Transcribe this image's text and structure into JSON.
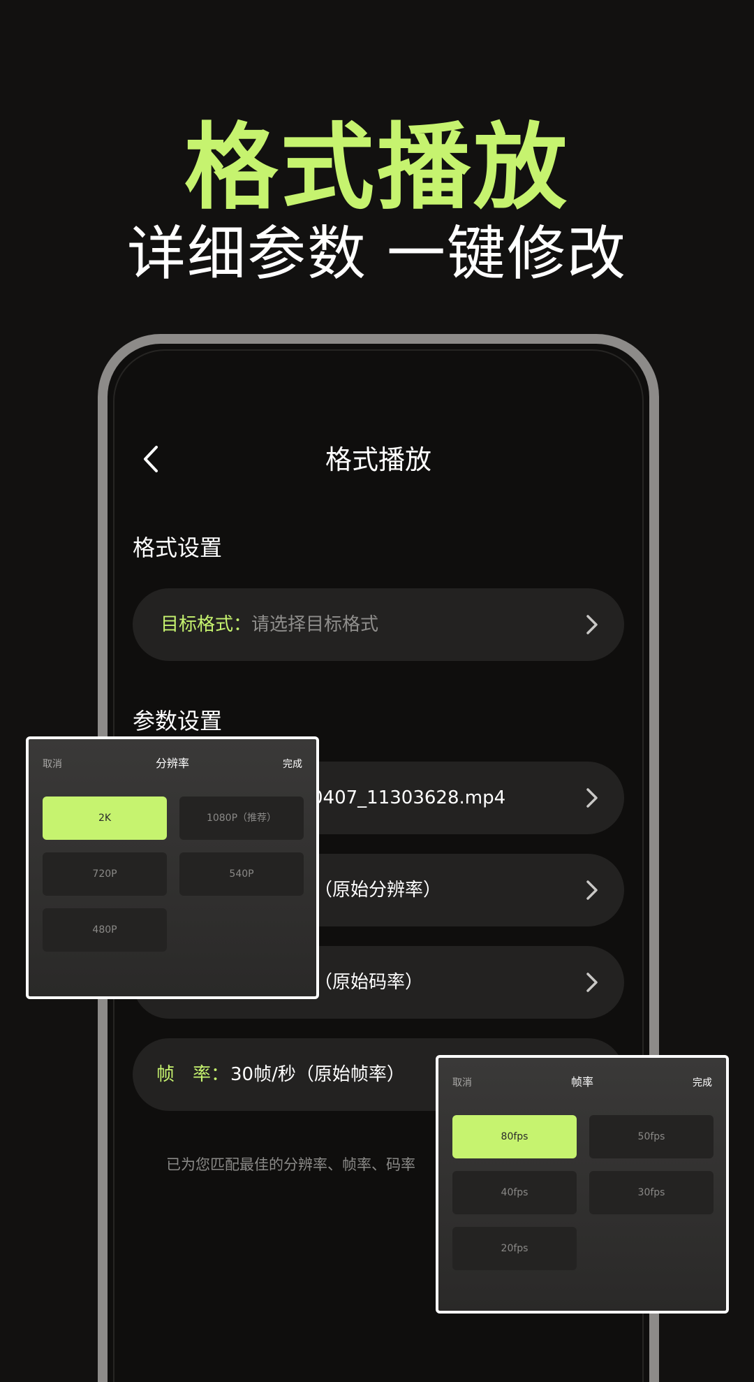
{
  "hero": {
    "title": "格式播放",
    "subtitle_left": "详细参数",
    "subtitle_right": "一键修改"
  },
  "nav": {
    "title": "格式播放"
  },
  "format_section": {
    "title": "格式设置",
    "row": {
      "label": "目标格式：",
      "placeholder": "请选择目标格式"
    }
  },
  "params_section": {
    "title": "参数设置",
    "rows": [
      {
        "value": "0407_11303628.mp4"
      },
      {
        "value": "（原始分辨率）"
      },
      {
        "value": "（原始码率）"
      },
      {
        "label": "帧　率：",
        "value": "30帧/秒（原始帧率）"
      }
    ],
    "hint": "已为您匹配最佳的分辨率、帧率、码率"
  },
  "resolution_popup": {
    "cancel": "取消",
    "title": "分辨率",
    "done": "完成",
    "options": [
      "2K",
      "1080P（推荐）",
      "720P",
      "540P",
      "480P"
    ],
    "selected": "2K"
  },
  "fps_popup": {
    "cancel": "取消",
    "title": "帧率",
    "done": "完成",
    "options": [
      "80fps",
      "50fps",
      "40fps",
      "30fps",
      "20fps"
    ],
    "selected": "80fps"
  },
  "colors": {
    "accent": "#c6f36f",
    "background": "#121110",
    "row": "#232221",
    "frame": "#8d8b89"
  },
  "icons": {
    "back": "chevron-left-icon",
    "row_arrow": "chevron-right-icon"
  }
}
